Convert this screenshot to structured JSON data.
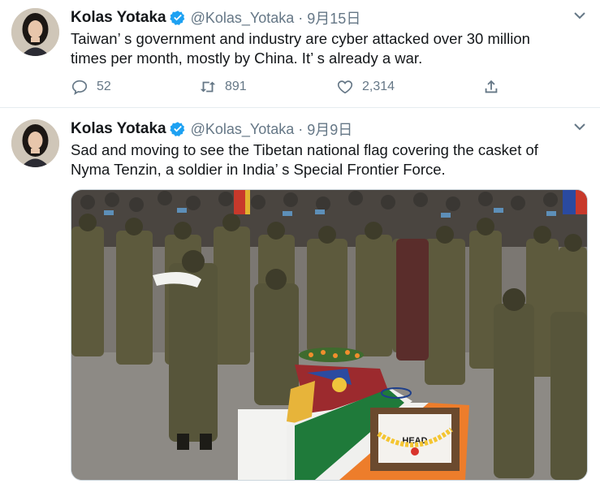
{
  "tweets": [
    {
      "author_name": "Kolas Yotaka",
      "handle": "@Kolas_Yotaka",
      "separator": "·",
      "date": "9月15日",
      "text_line1": "Taiwan’ s government and industry are cyber attacked over 30 million",
      "text_line2": "times per month, mostly by China. It’ s already a war.",
      "reply_count": "52",
      "retweet_count": "891",
      "like_count": "2,314"
    },
    {
      "author_name": "Kolas Yotaka",
      "handle": "@Kolas_Yotaka",
      "separator": "·",
      "date": "9月9日",
      "text_line1": "Sad and moving to see the Tibetan national flag covering the casket of",
      "text_line2": "Nyma Tenzin, a soldier in India’ s Special Frontier Force.",
      "photo_label": "HEAD"
    }
  ],
  "icons": {
    "verified": "verified-badge-icon",
    "caret": "chevron-down-icon",
    "reply": "reply-icon",
    "retweet": "retweet-icon",
    "like": "heart-icon",
    "share": "share-icon"
  },
  "colors": {
    "verified_blue": "#1da1f2",
    "secondary_text": "#657786",
    "primary_text": "#14171a",
    "divider": "#e6ecf0"
  }
}
